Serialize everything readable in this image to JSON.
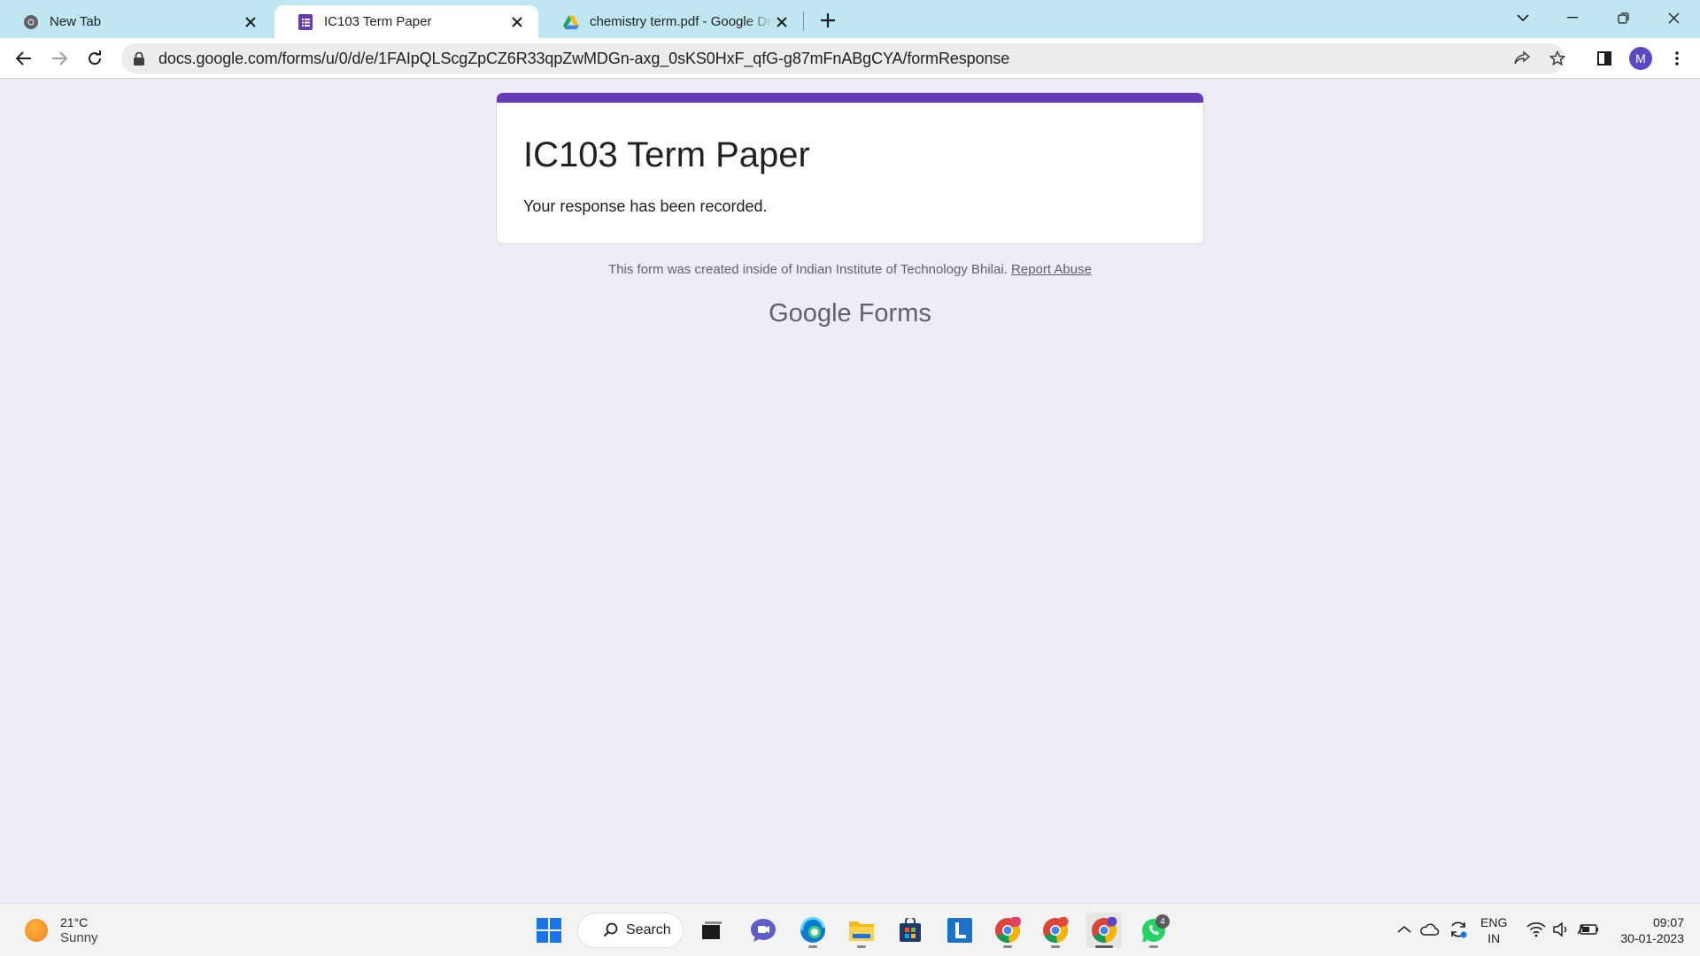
{
  "browser": {
    "tabs": [
      {
        "title": "New Tab",
        "icon": "chrome-icon",
        "active": false
      },
      {
        "title": "IC103 Term Paper",
        "icon": "google-forms-icon",
        "active": true
      },
      {
        "title": "chemistry term.pdf - Google Drive",
        "icon": "google-drive-icon",
        "active": false
      }
    ],
    "url": "docs.google.com/forms/u/0/d/e/1FAIpQLScgZpCZ6R33qpZwMDGn-axg_0sKS0HxF_qfG-g87mFnABgCYA/formResponse",
    "profile_initial": "M"
  },
  "form": {
    "title": "IC103 Term Paper",
    "confirmation": "Your response has been recorded.",
    "footer_text": "This form was created inside of Indian Institute of Technology Bhilai.",
    "report_link": "Report Abuse",
    "brand_google": "Google",
    "brand_forms": "Forms"
  },
  "taskbar": {
    "weather_temp": "21°C",
    "weather_cond": "Sunny",
    "search_label": "Search",
    "whatsapp_badge": "4",
    "lang_top": "ENG",
    "lang_bottom": "IN",
    "time": "09:07",
    "date": "30-01-2023"
  },
  "colors": {
    "forms_accent": "#673ab7",
    "page_bg": "#efebf7",
    "tabstrip_bg": "#bfe6f1"
  }
}
